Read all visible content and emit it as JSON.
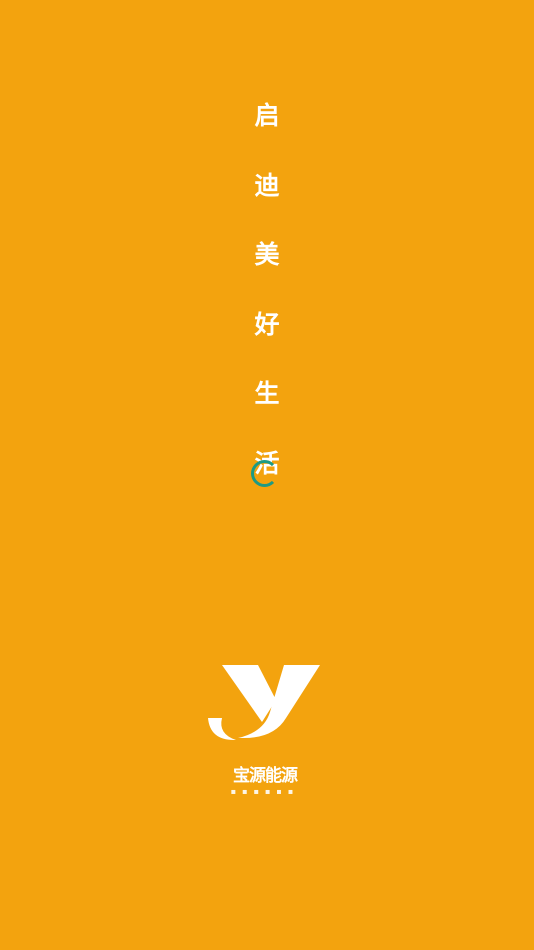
{
  "splash": {
    "slogan_chars": [
      "启",
      "迪",
      "美",
      "好",
      "生",
      "活"
    ],
    "background_color": "#F3A30E",
    "spinner_color": "#1D9A84",
    "loading": true
  },
  "brand": {
    "logo_icon": "yy-logo-icon",
    "name": "宝源能源"
  }
}
